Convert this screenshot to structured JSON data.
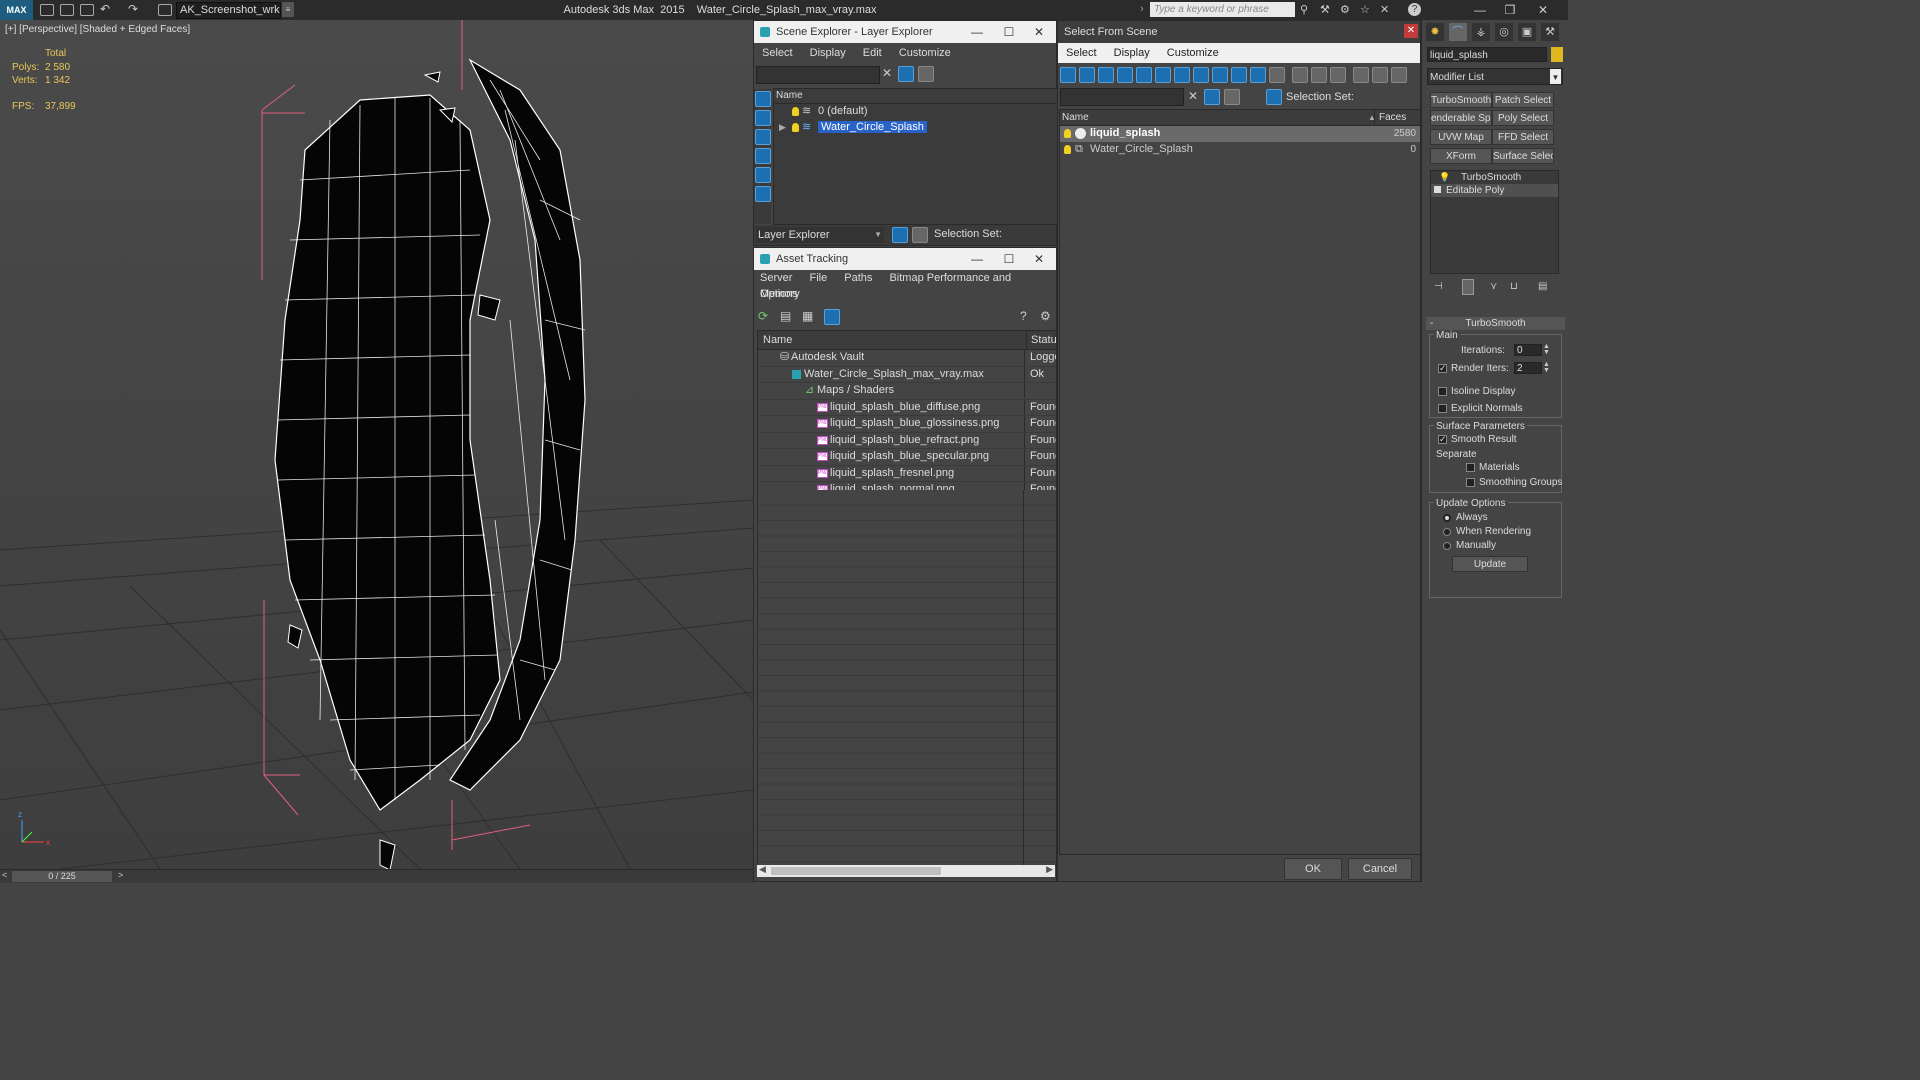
{
  "titlebar": {
    "logo": "MAX",
    "workspace": "AK_Screenshot_wrksp",
    "app_title": "Autodesk 3ds Max  2015    Water_Circle_Splash_max_vray.max",
    "search_placeholder": "Type a keyword or phrase"
  },
  "viewport": {
    "label": "[+] [Perspective] [Shaded + Edged Faces]",
    "stats": {
      "total_label": "Total",
      "polys_label": "Polys:",
      "polys_value": "2 580",
      "verts_label": "Verts:",
      "verts_value": "1 342",
      "fps_label": "FPS:",
      "fps_value": "37,899"
    },
    "axis_z": "z",
    "axis_x": "x"
  },
  "timeline": {
    "frame": "0 / 225",
    "prev": "<",
    "next": ">"
  },
  "scene_explorer": {
    "title": "Scene Explorer - Layer Explorer",
    "menu": [
      "Select",
      "Display",
      "Edit",
      "Customize"
    ],
    "column_name": "Name",
    "layers": [
      {
        "name": "0 (default)",
        "selected": false
      },
      {
        "name": "Water_Circle_Splash",
        "selected": true
      }
    ],
    "footer_dropdown": "Layer Explorer",
    "selection_set_label": "Selection Set:"
  },
  "asset_tracking": {
    "title": "Asset Tracking",
    "menu": [
      "Server",
      "File",
      "Paths",
      "Bitmap Performance and Memory"
    ],
    "menu_row2": [
      "Options"
    ],
    "col_name": "Name",
    "col_status": "Status",
    "rows": [
      {
        "name": "Autodesk Vault",
        "status": "Logged",
        "indent": 0,
        "icon": "vault"
      },
      {
        "name": "Water_Circle_Splash_max_vray.max",
        "status": "Ok",
        "indent": 1,
        "icon": "max"
      },
      {
        "name": "Maps / Shaders",
        "status": "",
        "indent": 2,
        "icon": "maps"
      },
      {
        "name": "liquid_splash_blue_diffuse.png",
        "status": "Found",
        "indent": 3,
        "icon": "png"
      },
      {
        "name": "liquid_splash_blue_glossiness.png",
        "status": "Found",
        "indent": 3,
        "icon": "png"
      },
      {
        "name": "liquid_splash_blue_refract.png",
        "status": "Found",
        "indent": 3,
        "icon": "png"
      },
      {
        "name": "liquid_splash_blue_specular.png",
        "status": "Found",
        "indent": 3,
        "icon": "png"
      },
      {
        "name": "liquid_splash_fresnel.png",
        "status": "Found",
        "indent": 3,
        "icon": "png"
      },
      {
        "name": "liquid_splash_normal.png",
        "status": "Found",
        "indent": 3,
        "icon": "png"
      }
    ]
  },
  "select_from_scene": {
    "title": "Select From Scene",
    "menu": [
      "Select",
      "Display",
      "Customize"
    ],
    "selection_set_label": "Selection Set:",
    "col_name": "Name",
    "col_faces": "Faces",
    "rows": [
      {
        "name": "liquid_splash",
        "faces": "2580",
        "selected": true
      },
      {
        "name": "Water_Circle_Splash",
        "faces": "0",
        "selected": false
      }
    ],
    "ok": "OK",
    "cancel": "Cancel"
  },
  "command_panel": {
    "object_name": "liquid_splash",
    "modifier_list": "Modifier List",
    "buttons": [
      "TurboSmooth",
      "Patch Select",
      "enderable Spli",
      "Poly Select",
      "UVW Map",
      "FFD Select",
      "XForm",
      "Surface Select"
    ],
    "stack": [
      "TurboSmooth",
      "Editable Poly"
    ],
    "rollout_title": "TurboSmooth",
    "main_label": "Main",
    "iterations_label": "Iterations:",
    "iterations_value": "0",
    "render_iters_label": "Render Iters:",
    "render_iters_value": "2",
    "isoline_label": "Isoline Display",
    "explicit_label": "Explicit Normals",
    "surface_label": "Surface Parameters",
    "smooth_label": "Smooth Result",
    "separate_label": "Separate",
    "materials_label": "Materials",
    "smoothing_label": "Smoothing Groups",
    "update_options_label": "Update Options",
    "always_label": "Always",
    "when_rendering_label": "When Rendering",
    "manually_label": "Manually",
    "update_button": "Update",
    "colors": {
      "accent": "#2a63c7",
      "stats": "#e8c65a"
    }
  }
}
